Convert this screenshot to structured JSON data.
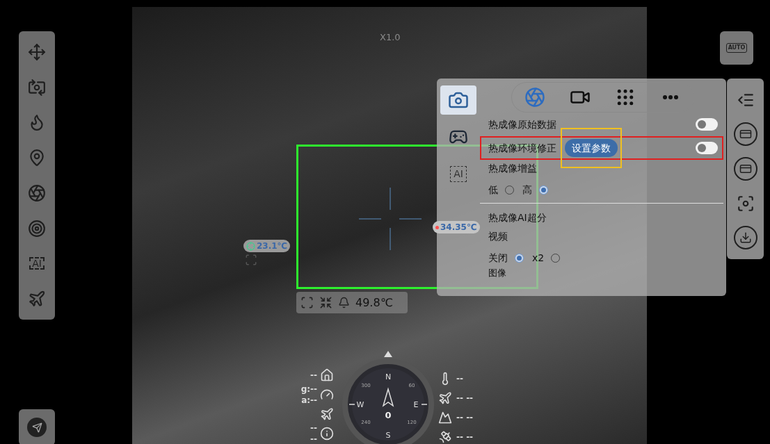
{
  "zoom_label": "X1.0",
  "left_toolbar": {
    "items": [
      {
        "kind": "pan"
      },
      {
        "kind": "switch-camera"
      },
      {
        "kind": "fire"
      },
      {
        "kind": "pins"
      },
      {
        "kind": "aperture"
      },
      {
        "kind": "target"
      },
      {
        "kind": "ai",
        "label": "AI"
      },
      {
        "kind": "planes"
      }
    ]
  },
  "markers": [
    {
      "kind": "point",
      "reading": "23.1℃"
    },
    {
      "kind": "hot",
      "reading": "34.35℃"
    }
  ],
  "alarm_bar": {
    "reading": "49.8℃"
  },
  "settings_panel": {
    "camera_selected": true,
    "tabs": [
      {
        "kind": "aperture",
        "selected": true
      },
      {
        "kind": "video",
        "selected": false
      },
      {
        "kind": "grid",
        "selected": false
      },
      {
        "kind": "more",
        "selected": false
      }
    ],
    "side_ai_label": "AI",
    "rows": [
      {
        "kind": "toggle",
        "label": "热成像原始数据",
        "on": false
      },
      {
        "kind": "toggle",
        "label": "热成像环境修正",
        "button": "设置参数",
        "on": false,
        "highlighted": true
      },
      {
        "kind": "radio",
        "label": "热成像增益",
        "options": [
          {
            "label": "低",
            "selected": false
          },
          {
            "label": "高",
            "selected": true
          }
        ]
      },
      {
        "kind": "divider"
      },
      {
        "kind": "radio",
        "label": "热成像AI超分",
        "sublabel": "视频",
        "options": [
          {
            "label": "关闭",
            "selected": true
          },
          {
            "label": "x2",
            "selected": false
          }
        ]
      },
      {
        "kind": "heading",
        "label": "图像"
      }
    ]
  },
  "auto_button": "AUTO",
  "right_toolbar": {
    "items": [
      {
        "kind": "list"
      },
      {
        "kind": "card"
      },
      {
        "kind": "card"
      },
      {
        "kind": "focus"
      },
      {
        "kind": "download"
      }
    ]
  },
  "telemetry_left": [
    {
      "kind": "home",
      "text": "--"
    },
    {
      "kind": "speed",
      "text": "g:--",
      "text2": "a:--"
    },
    {
      "kind": "plane-pin"
    },
    {
      "kind": "signal",
      "text": "--",
      "text2": "--"
    }
  ],
  "compass": {
    "north": "N",
    "south": "S",
    "east": "E",
    "west": "W",
    "ticks": [
      "300",
      "60",
      "240",
      "120"
    ],
    "heading": "0"
  },
  "telemetry_right": [
    {
      "kind": "thermo",
      "text": "--"
    },
    {
      "kind": "height",
      "text": "-- --"
    },
    {
      "kind": "mountain",
      "text": "-- --"
    },
    {
      "kind": "satellite",
      "text": "-- --"
    }
  ]
}
